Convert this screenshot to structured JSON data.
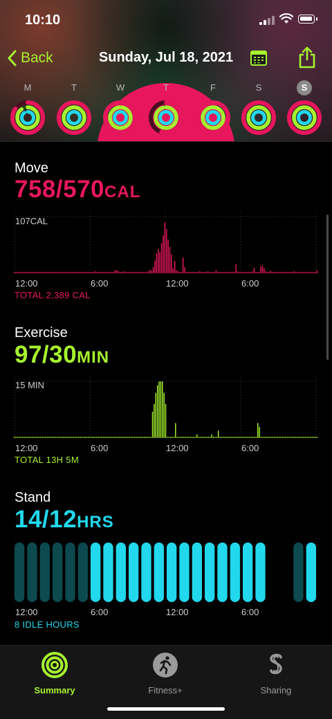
{
  "status_bar": {
    "time": "10:10"
  },
  "nav": {
    "back_label": "Back",
    "title": "Sunday, Jul 18, 2021"
  },
  "colors": {
    "move": "#e8175d",
    "exercise": "#a6f32e",
    "stand": "#22d8ec",
    "accent": "#a6f32e"
  },
  "week": [
    {
      "letter": "M",
      "selected": false,
      "move": 0.85,
      "exercise": 0.9,
      "stand": 0.9
    },
    {
      "letter": "T",
      "selected": false,
      "move": 1.0,
      "exercise": 1.0,
      "stand": 1.0
    },
    {
      "letter": "W",
      "selected": false,
      "move": 1.0,
      "exercise": 1.0,
      "stand": 1.0
    },
    {
      "letter": "T",
      "selected": false,
      "move": 0.55,
      "exercise": 0.95,
      "stand": 0.95
    },
    {
      "letter": "F",
      "selected": false,
      "move": 1.0,
      "exercise": 1.0,
      "stand": 1.0
    },
    {
      "letter": "S",
      "selected": false,
      "move": 1.0,
      "exercise": 1.0,
      "stand": 1.0
    },
    {
      "letter": "S",
      "selected": true,
      "move": 1.0,
      "exercise": 1.0,
      "stand": 1.0
    }
  ],
  "move": {
    "title": "Move",
    "value": "758/570",
    "unit": "CAL",
    "y_label": "107CAL",
    "total": "TOTAL 2,389 CAL",
    "x_ticks": [
      "12:00",
      "6:00",
      "12:00",
      "6:00"
    ]
  },
  "exercise": {
    "title": "Exercise",
    "value": "97/30",
    "unit": "MIN",
    "y_label": "15 MIN",
    "total": "TOTAL 13H 5M",
    "x_ticks": [
      "12:00",
      "6:00",
      "12:00",
      "6:00"
    ]
  },
  "stand": {
    "title": "Stand",
    "value": "14/12",
    "unit": "HRS",
    "total": "8 IDLE HOURS",
    "x_ticks": [
      "12:00",
      "6:00",
      "12:00",
      "6:00"
    ]
  },
  "chart_data": [
    {
      "type": "bar",
      "title": "Move",
      "ylabel": "CAL",
      "ylim": [
        0,
        107
      ],
      "x_ticks": [
        "12:00",
        "6:00",
        "12:00",
        "6:00"
      ],
      "values": [
        3,
        3,
        3,
        3,
        3,
        3,
        3,
        3,
        3,
        3,
        3,
        3,
        3,
        3,
        3,
        3,
        3,
        3,
        3,
        3,
        3,
        3,
        3,
        3,
        3,
        3,
        3,
        3,
        3,
        3,
        3,
        3,
        3,
        3,
        3,
        3,
        3,
        3,
        3,
        3,
        3,
        3,
        3,
        3,
        3,
        3,
        3,
        3,
        3,
        4,
        3,
        3,
        3,
        3,
        3,
        3,
        3,
        3,
        3,
        3,
        3,
        6,
        6,
        4,
        3,
        3,
        4,
        3,
        3,
        3,
        3,
        3,
        3,
        3,
        3,
        3,
        3,
        3,
        3,
        3,
        3,
        4,
        7,
        5,
        12,
        24,
        38,
        46,
        40,
        57,
        72,
        96,
        84,
        64,
        50,
        36,
        10,
        24,
        6,
        4,
        3,
        3,
        30,
        12,
        3,
        3,
        3,
        3,
        3,
        3,
        3,
        3,
        4,
        3,
        3,
        3,
        3,
        4,
        3,
        3,
        3,
        3,
        6,
        3,
        3,
        3,
        3,
        3,
        3,
        3,
        3,
        3,
        3,
        3,
        18,
        4,
        3,
        3,
        3,
        3,
        3,
        3,
        3,
        3,
        4,
        11,
        3,
        3,
        3,
        13,
        15,
        10,
        4,
        3,
        3,
        5,
        3,
        3,
        3,
        3,
        3,
        3,
        3,
        3,
        3,
        3,
        3,
        3,
        3,
        4,
        3,
        3,
        3,
        3,
        3,
        3,
        3,
        3,
        3,
        3,
        3,
        3,
        3,
        6
      ]
    },
    {
      "type": "bar",
      "title": "Exercise",
      "ylabel": "MIN",
      "ylim": [
        0,
        15
      ],
      "x_ticks": [
        "12:00",
        "6:00",
        "12:00",
        "6:00"
      ],
      "values": [
        0,
        0,
        0,
        0,
        0,
        0,
        0,
        0,
        0,
        0,
        0,
        0,
        0,
        0,
        0,
        0,
        0,
        0,
        0,
        0,
        0,
        0,
        0,
        0,
        0,
        0,
        0,
        0,
        0,
        0,
        0,
        0,
        0,
        0,
        0,
        0,
        0,
        0,
        0,
        0,
        0,
        0,
        0,
        0,
        0,
        0,
        0,
        0,
        0,
        0,
        0,
        0,
        0,
        0,
        0,
        0,
        0,
        0,
        0,
        0,
        0,
        0,
        0,
        0,
        0,
        0,
        0,
        0,
        0,
        0,
        0,
        0,
        0,
        0,
        0,
        0,
        0,
        0,
        0,
        0,
        0,
        0,
        0,
        0,
        7,
        9,
        12,
        14,
        15,
        15,
        15,
        12,
        9,
        0,
        0,
        0,
        0,
        0,
        4,
        0,
        0,
        0,
        0,
        0,
        0,
        0,
        0,
        0,
        0,
        0,
        0,
        1,
        0,
        0,
        0,
        0,
        0,
        0,
        0,
        0,
        1,
        0,
        0,
        0,
        2,
        0,
        0,
        0,
        0,
        0,
        0,
        0,
        0,
        0,
        0,
        0,
        0,
        0,
        0,
        0,
        0,
        0,
        0,
        0,
        0,
        0,
        0,
        0,
        4,
        3,
        0,
        0,
        0,
        0,
        0,
        0,
        0,
        0,
        0,
        0,
        0,
        0,
        0,
        0,
        0,
        0,
        0,
        0,
        0,
        0,
        0,
        0,
        0,
        0,
        0,
        0,
        0,
        0,
        0,
        0,
        0,
        0,
        0,
        0,
        0
      ]
    },
    {
      "type": "bar",
      "title": "Stand",
      "ylabel": "HRS",
      "x_ticks": [
        "12:00",
        "6:00",
        "12:00",
        "6:00"
      ],
      "series": [
        {
          "name": "stood",
          "values": [
            0,
            0,
            0,
            0,
            0,
            0,
            1,
            1,
            1,
            1,
            1,
            1,
            1,
            1,
            1,
            1,
            1,
            1,
            1,
            1,
            0,
            0,
            0,
            1
          ]
        },
        {
          "name": "idle",
          "values": [
            1,
            1,
            1,
            1,
            1,
            1,
            0,
            0,
            0,
            0,
            0,
            0,
            0,
            0,
            0,
            0,
            0,
            0,
            0,
            0,
            0,
            0,
            1,
            0
          ]
        }
      ]
    }
  ],
  "tabs": [
    {
      "label": "Summary",
      "icon": "activity-rings-icon",
      "active": true
    },
    {
      "label": "Fitness+",
      "icon": "runner-icon",
      "active": false
    },
    {
      "label": "Sharing",
      "icon": "sharing-icon",
      "active": false
    }
  ]
}
